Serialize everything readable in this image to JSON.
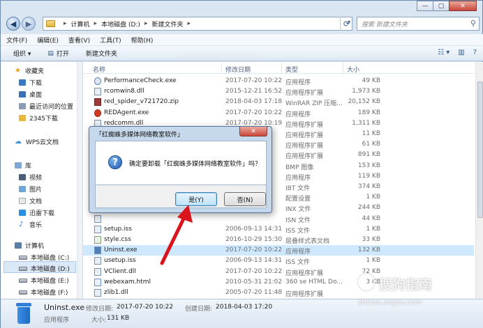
{
  "window": {
    "buttons": {
      "minimize": "—",
      "maximize": "▢",
      "close": "✕"
    }
  },
  "address": {
    "crumbs": [
      "计算机",
      "本地磁盘 (D:)",
      "新建文件夹"
    ],
    "search_placeholder": "搜索 新建文件夹"
  },
  "menu": [
    "文件(F)",
    "编辑(E)",
    "查看(V)",
    "工具(T)",
    "帮助(H)"
  ],
  "toolbar": {
    "organize": "组织 ▾",
    "open": "打开",
    "new_folder": "新建文件夹"
  },
  "nav": {
    "favorites": "收藏夹",
    "downloads": "下载",
    "desktop": "桌面",
    "recent": "最近访问的位置",
    "app2345": "2345下载",
    "wps": "WPS云文档",
    "libraries": "库",
    "videos": "视频",
    "pictures": "图片",
    "documents": "文档",
    "xunlei": "迅雷下载",
    "music": "音乐",
    "computer": "计算机",
    "drives": [
      "本地磁盘 (C:)",
      "本地磁盘 (D:)",
      "本地磁盘 (E:)",
      "本地磁盘 (F:)"
    ]
  },
  "columns": {
    "name": "名称",
    "date": "修改日期",
    "type": "类型",
    "size": "大小"
  },
  "files": [
    {
      "name": "PerformanceCheck.exe",
      "date": "2017-07-20 10:22",
      "type": "应用程序",
      "size": "49 KB",
      "icon": "perf"
    },
    {
      "name": "rcomwin8.dll",
      "date": "2015-12-21 16:52",
      "type": "应用程序扩展",
      "size": "1,973 KB",
      "icon": "ex"
    },
    {
      "name": "red_spider_v721720.zip",
      "date": "2018-04-03 17:18",
      "type": "WinRAR ZIP 压缩...",
      "size": "20,152 KB",
      "icon": "zip"
    },
    {
      "name": "REDAgent.exe",
      "date": "2017-07-20 10:22",
      "type": "应用程序",
      "size": "189 KB",
      "icon": "red"
    },
    {
      "name": "redcomm.dll",
      "date": "2017-07-20 10:19",
      "type": "应用程序扩展",
      "size": "1,311 KB",
      "icon": "ex"
    },
    {
      "name": "",
      "date": "",
      "type": "应用程序扩展",
      "size": "11 KB",
      "icon": "ex"
    },
    {
      "name": "",
      "date": "",
      "type": "应用程序扩展",
      "size": "61 KB",
      "icon": "ex"
    },
    {
      "name": "",
      "date": "",
      "type": "应用程序扩展",
      "size": "891 KB",
      "icon": "ex"
    },
    {
      "name": "",
      "date": "",
      "type": "BMP 图像",
      "size": "153 KB",
      "icon": "ex"
    },
    {
      "name": "",
      "date": "",
      "type": "应用程序",
      "size": "119 KB",
      "icon": "ex"
    },
    {
      "name": "",
      "date": "",
      "type": "IBT 文件",
      "size": "374 KB",
      "icon": "ex"
    },
    {
      "name": "",
      "date": "",
      "type": "配置设置",
      "size": "1 KB",
      "icon": "ex"
    },
    {
      "name": "",
      "date": "",
      "type": "INX 文件",
      "size": "244 KB",
      "icon": "ex"
    },
    {
      "name": "",
      "date": "",
      "type": "ISN 文件",
      "size": "44 KB",
      "icon": "ex"
    },
    {
      "name": "setup.iss",
      "date": "2006-09-13 14:31",
      "type": "ISS 文件",
      "size": "1 KB",
      "icon": "ex"
    },
    {
      "name": "style.css",
      "date": "2016-10-29 15:30",
      "type": "层叠样式表文档",
      "size": "33 KB",
      "icon": "css"
    },
    {
      "name": "Uninst.exe",
      "date": "2017-07-20 10:22",
      "type": "应用程序",
      "size": "132 KB",
      "icon": "ex",
      "selected": true
    },
    {
      "name": "usetup.iss",
      "date": "2006-09-13 14:31",
      "type": "ISS 文件",
      "size": "1 KB",
      "icon": "ex"
    },
    {
      "name": "VClient.dll",
      "date": "2017-07-20 10:22",
      "type": "应用程序扩展",
      "size": "72 KB",
      "icon": "ex"
    },
    {
      "name": "webexam.html",
      "date": "2010-05-31 21:02",
      "type": "360 se HTML Do...",
      "size": "3 KB",
      "icon": "htm"
    },
    {
      "name": "zlib1.dll",
      "date": "2005-07-20 11:48",
      "type": "应用程序扩展",
      "size": "",
      "icon": "ex"
    }
  ],
  "details": {
    "name": "Uninst.exe",
    "modified_label": "修改日期:",
    "modified": "2017-07-20 10:22",
    "created_label": "创建日期:",
    "created": "2018-04-03 17:20",
    "type": "应用程序",
    "size_label": "大小:",
    "size": "131 KB"
  },
  "dialog": {
    "title": "「红蜘蛛多媒体网络教室软件」",
    "message": "确定要卸载「红蜘蛛多媒体网络教室软件」吗？",
    "yes": "是(Y)",
    "no": "否(N)",
    "close": "✕"
  },
  "watermark": {
    "brand": "搜狗指南",
    "url": "zhinan.sogou.com"
  },
  "colors": {
    "accent": "#3c7fb1",
    "arrow": "#d9141b",
    "selection": "#cde8ff"
  }
}
